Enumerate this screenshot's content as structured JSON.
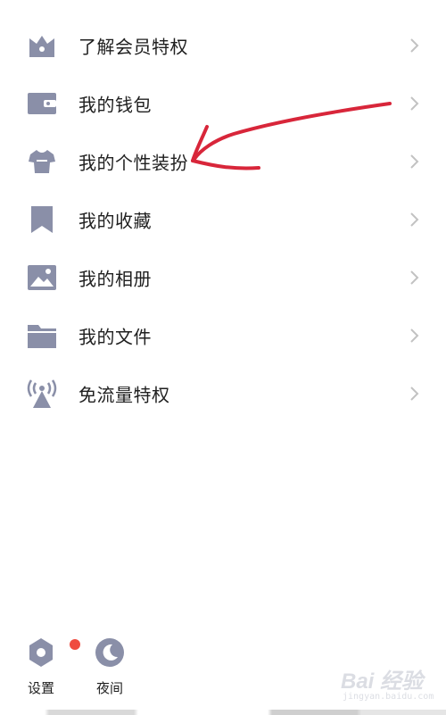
{
  "menu": {
    "items": [
      {
        "label": "了解会员特权",
        "icon": "crown-icon"
      },
      {
        "label": "我的钱包",
        "icon": "wallet-icon"
      },
      {
        "label": "我的个性装扮",
        "icon": "tshirt-icon"
      },
      {
        "label": "我的收藏",
        "icon": "bookmark-icon"
      },
      {
        "label": "我的相册",
        "icon": "photo-icon"
      },
      {
        "label": "我的文件",
        "icon": "folder-icon"
      },
      {
        "label": "免流量特权",
        "icon": "signal-tower-icon"
      }
    ]
  },
  "bottom": {
    "settings_label": "设置",
    "night_label": "夜间"
  },
  "watermark": {
    "text": "Bai 经验",
    "sub": "jingyan.baidu.com"
  },
  "colors": {
    "icon": "#8a8fa8",
    "text": "#1f1f1f",
    "chevron": "#c2c2c2",
    "badge": "#ef4b3f",
    "annotation": "#d8263a"
  }
}
